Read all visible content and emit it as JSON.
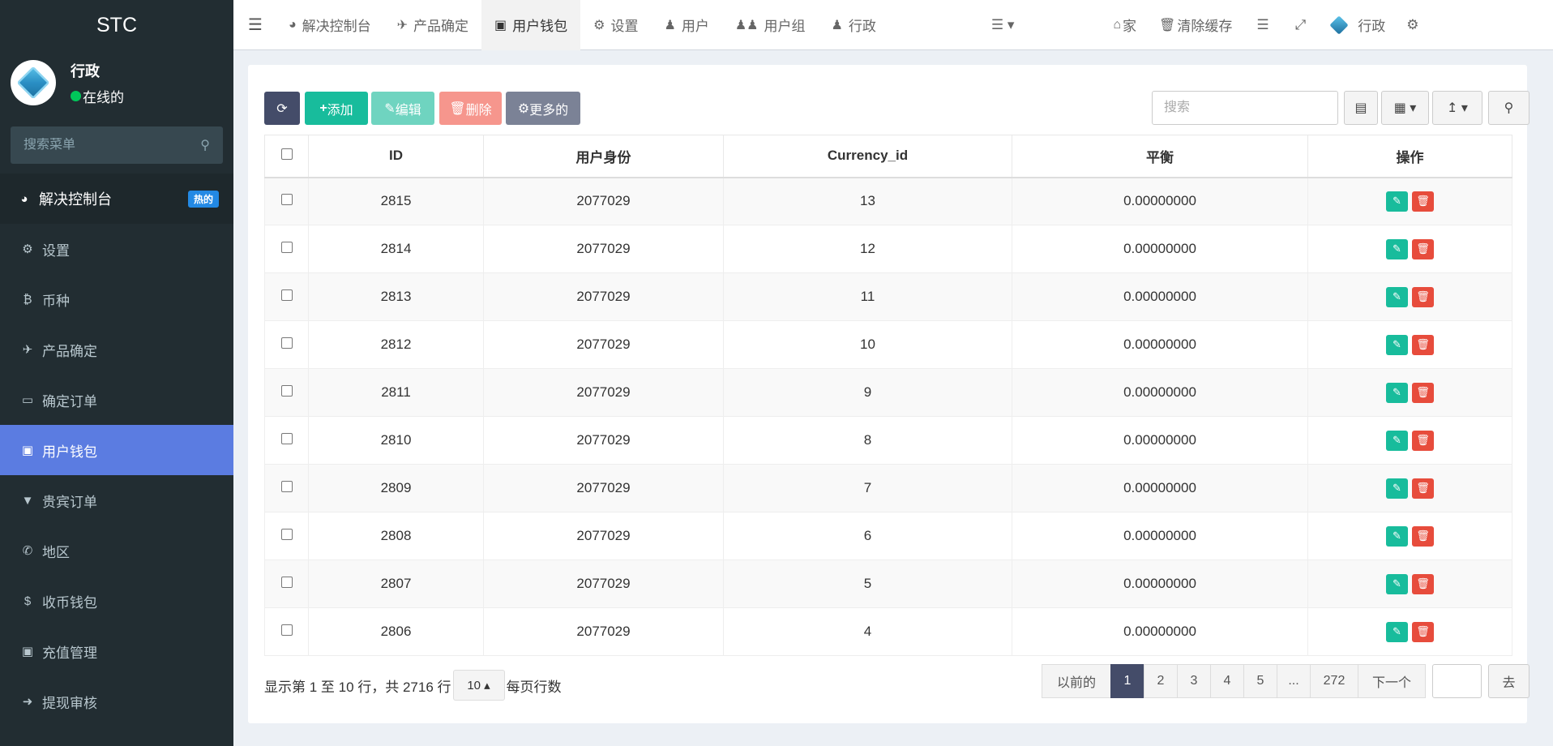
{
  "brand": "STC",
  "user": {
    "name": "行政",
    "status": "在线的"
  },
  "sidebar": {
    "search_placeholder": "搜索菜单",
    "items": [
      {
        "label": "解决控制台",
        "icon": "dashboard-icon",
        "badge": "热的"
      },
      {
        "label": "设置",
        "icon": "gear-icon"
      },
      {
        "label": "币种",
        "icon": "bitcoin-icon"
      },
      {
        "label": "产品确定",
        "icon": "plane-icon"
      },
      {
        "label": "确定订单",
        "icon": "book-icon"
      },
      {
        "label": "用户钱包",
        "icon": "money-icon"
      },
      {
        "label": "贵宾订单",
        "icon": "chevron-circle-icon"
      },
      {
        "label": "地区",
        "icon": "phone-square-icon"
      },
      {
        "label": "收币钱包",
        "icon": "dollar-icon"
      },
      {
        "label": "充值管理",
        "icon": "money-icon"
      },
      {
        "label": "提现审核",
        "icon": "chevron-circle-icon"
      }
    ]
  },
  "topnav": {
    "tabs": [
      {
        "label": "解决控制台",
        "icon": "dashboard-icon"
      },
      {
        "label": "产品确定",
        "icon": "plane-icon"
      },
      {
        "label": "用户钱包",
        "icon": "money-icon"
      },
      {
        "label": "设置",
        "icon": "gear-icon"
      },
      {
        "label": "用户",
        "icon": "user-icon"
      },
      {
        "label": "用户组",
        "icon": "users-icon"
      },
      {
        "label": "行政",
        "icon": "user-icon"
      }
    ],
    "home": "家",
    "clear_cache": "清除缓存",
    "admin": "行政"
  },
  "toolbar": {
    "add": "添加",
    "edit": "编辑",
    "delete": "删除",
    "more": "更多的",
    "search_placeholder": "搜索"
  },
  "table": {
    "headers": [
      "ID",
      "用户身份",
      "Currency_id",
      "平衡",
      "操作"
    ],
    "rows": [
      [
        "2815",
        "2077029",
        "13",
        "0.00000000"
      ],
      [
        "2814",
        "2077029",
        "12",
        "0.00000000"
      ],
      [
        "2813",
        "2077029",
        "11",
        "0.00000000"
      ],
      [
        "2812",
        "2077029",
        "10",
        "0.00000000"
      ],
      [
        "2811",
        "2077029",
        "9",
        "0.00000000"
      ],
      [
        "2810",
        "2077029",
        "8",
        "0.00000000"
      ],
      [
        "2809",
        "2077029",
        "7",
        "0.00000000"
      ],
      [
        "2808",
        "2077029",
        "6",
        "0.00000000"
      ],
      [
        "2807",
        "2077029",
        "5",
        "0.00000000"
      ],
      [
        "2806",
        "2077029",
        "4",
        "0.00000000"
      ]
    ]
  },
  "footer": {
    "summary": "显示第 1 至 10 行，共 2716 行",
    "page_size": "10",
    "per_page": "每页行数",
    "prev": "以前的",
    "pages": [
      "1",
      "2",
      "3",
      "4",
      "5",
      "...",
      "272"
    ],
    "next": "下一个",
    "goto": "去"
  },
  "colors": {
    "sidebar_bg": "#222d32",
    "active": "#5b7ce1",
    "success": "#18bc9c",
    "danger": "#e74c3c"
  }
}
